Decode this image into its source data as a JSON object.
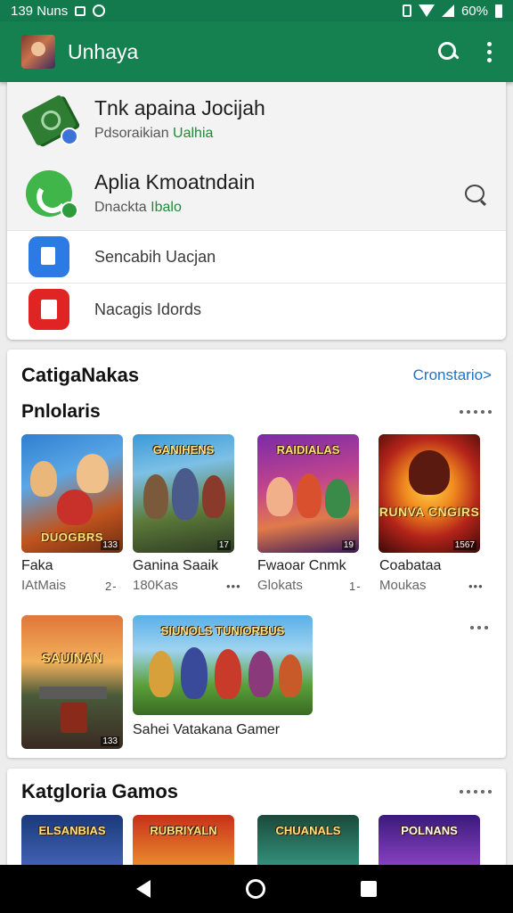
{
  "status_bar": {
    "time": "139 Νuns",
    "battery": "60%",
    "icons": [
      "photo-icon",
      "whatsapp-icon",
      "vibrate-icon",
      "wifi-icon",
      "signal-icon",
      "battery-icon"
    ]
  },
  "app_bar": {
    "title": "Unhaya",
    "icons": [
      "app-avatar",
      "search-icon",
      "more-options-icon"
    ],
    "color": "#158050"
  },
  "notifications": [
    {
      "title": "Tnk apaina Jocijah",
      "sub_prefix": "Pdsoraikian ",
      "sub_accent": "Ualhia",
      "icon": "money-icon"
    },
    {
      "title": "Aplia Kmoatndain",
      "sub_prefix": "Dnackta ",
      "sub_accent": "Ibalo",
      "icon": "phone-icon"
    },
    {
      "label": "Sencabih Uacjan",
      "icon": "blue-doc-icon"
    },
    {
      "label": "Nacagis Idords",
      "icon": "red-doc-icon"
    }
  ],
  "section1": {
    "title": "CatigaNakas",
    "link": "Cronstario>",
    "subtitle": "Pnlolaris",
    "games": [
      {
        "cap": "DUOGBRS",
        "count": "133",
        "name": "Faka",
        "meta": "IAtMais",
        "meta_right": "2-"
      },
      {
        "cap": "GANIHENS",
        "count": "17",
        "name": "Ganina Saaik",
        "meta": "180Kas",
        "meta_right": "•••"
      },
      {
        "cap": "RAIDIALAS",
        "count": "19",
        "name": "Fwaoar Cnmk",
        "meta": "Glokats",
        "meta_right": "1-"
      },
      {
        "cap": "RUNVA CNGIRS",
        "count": "1567",
        "name": "Coabataa",
        "meta": "Moukas",
        "meta_right": "•••"
      }
    ],
    "row2": [
      {
        "cap": "SAUINAN",
        "count": "133"
      },
      {
        "cap": "SIUNOLS TUNIORBUS",
        "name": "Sahei Vatakana Gamer"
      }
    ]
  },
  "section2": {
    "title": "Katgloria Gamos",
    "tiles": [
      "ELSANBIAS",
      "RUBRIYALN",
      "CHUANALS",
      "POLNANS"
    ]
  },
  "colors": {
    "accent_green": "#158050",
    "link_blue": "#1b73c9",
    "status_green": "#137a4e"
  }
}
